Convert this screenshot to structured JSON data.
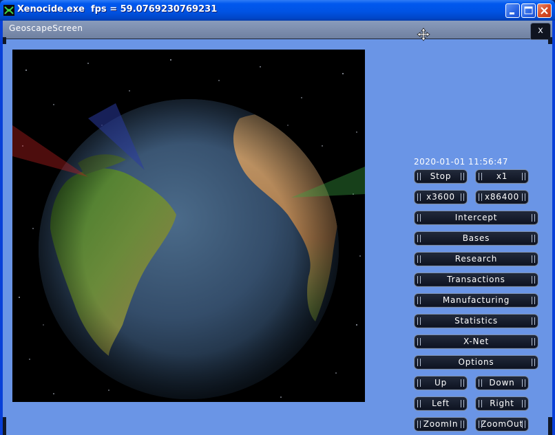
{
  "window": {
    "title": "Xenocide.exe  fps = 59.0769230769231",
    "controls": [
      "minimize",
      "maximize",
      "close"
    ]
  },
  "screen": {
    "title": "GeoscapeScreen",
    "close_label": "x"
  },
  "panel": {
    "datetime": "2020-01-01 11:56:47",
    "buttons": {
      "stop": "Stop",
      "x1": "x1",
      "x3600": "x3600",
      "x86400": "x86400",
      "intercept": "Intercept",
      "bases": "Bases",
      "research": "Research",
      "transactions": "Transactions",
      "manufacturing": "Manufacturing",
      "statistics": "Statistics",
      "xnet": "X-Net",
      "options": "Options",
      "up": "Up",
      "down": "Down",
      "left": "Left",
      "right": "Right",
      "zoomin": "ZoomIn",
      "zoomout": "ZoomOut"
    }
  },
  "colors": {
    "client_bg": "#6a95e6",
    "button_bg": "#111827",
    "titlebar": "#0053e4"
  }
}
